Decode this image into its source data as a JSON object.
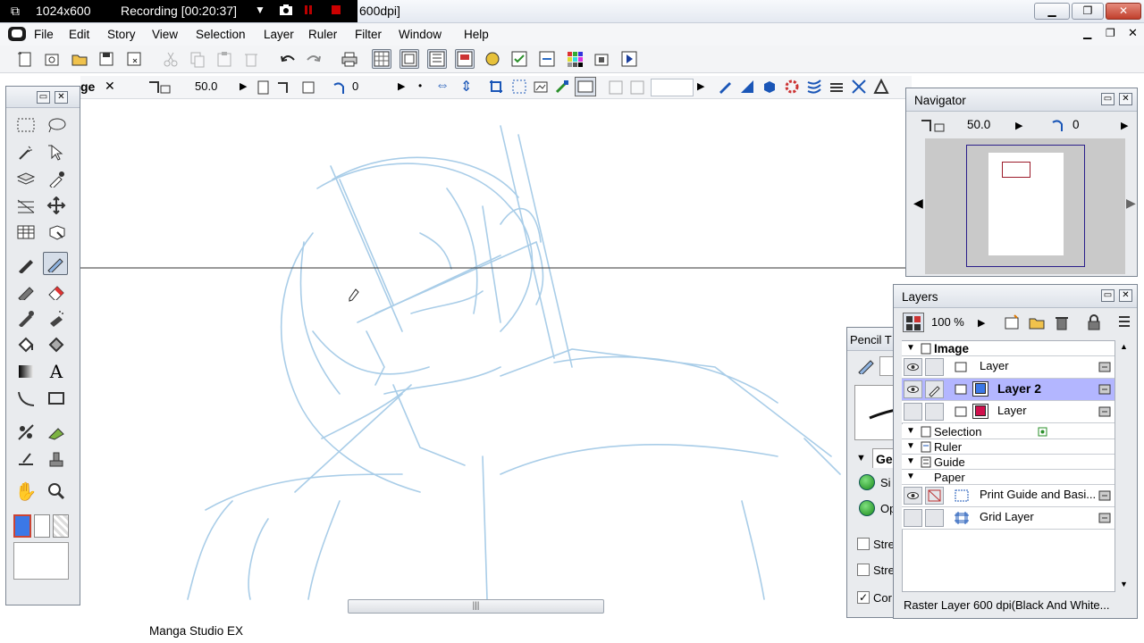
{
  "window": {
    "title_suffix": "600dpi]",
    "recording_resolution": "1024x600",
    "recording_status": "Recording [00:20:37]",
    "app_name": "Manga Studio EX"
  },
  "menu": [
    "File",
    "Edit",
    "Story",
    "View",
    "Selection",
    "Layer",
    "Ruler",
    "Filter",
    "Window",
    "Help"
  ],
  "tool_options": {
    "tab_label": "ge",
    "size_value": "50.0",
    "rotation_value": "0"
  },
  "tools_palette": {
    "tools": [
      "rect-select-icon",
      "lasso-icon",
      "magic-wand-icon",
      "object-select-icon",
      "layer-select-icon",
      "eyedropper-icon",
      "ruler-icon",
      "move-icon",
      "grid-icon",
      "transform-icon",
      "pen-icon",
      "pencil-icon",
      "marker-icon",
      "eraser-icon",
      "brush-icon",
      "airbrush-icon",
      "fill-icon",
      "pattern-fill-icon",
      "gradation-icon",
      "text-icon",
      "curve-icon",
      "rectangle-icon",
      "tone-icon",
      "tone-eraser-icon",
      "line-icon",
      "stamp-icon",
      "hand-icon",
      "zoom-icon"
    ],
    "active_tool": "pencil-icon"
  },
  "navigator": {
    "title": "Navigator",
    "zoom": "50.0",
    "rotation": "0"
  },
  "layers": {
    "title": "Layers",
    "opacity": "100 %",
    "groups": {
      "image": "Image",
      "selection": "Selection",
      "ruler": "Ruler",
      "guide": "Guide",
      "paper": "Paper"
    },
    "image_layers": [
      {
        "name": "Layer",
        "selected": false,
        "color": ""
      },
      {
        "name": "Layer 2",
        "selected": true,
        "color": "#3b78e7"
      },
      {
        "name": "Layer",
        "selected": false,
        "color": "#d0104c"
      }
    ],
    "paper_layers": [
      {
        "name": "Print Guide and Basi..."
      },
      {
        "name": "Grid Layer"
      }
    ],
    "status": "Raster Layer 600 dpi(Black And White..."
  },
  "pencil_panel": {
    "title": "Pencil T",
    "tab_label": "Ge",
    "option_si": "Si",
    "option_op": "Op",
    "check_stre1": "Stre",
    "check_stre2": "Stre",
    "check_cor": "Cor"
  },
  "colors": {
    "accent": "#3b78e7",
    "sketch": "#a9cde8",
    "selection_row": "#b3b6ff"
  }
}
